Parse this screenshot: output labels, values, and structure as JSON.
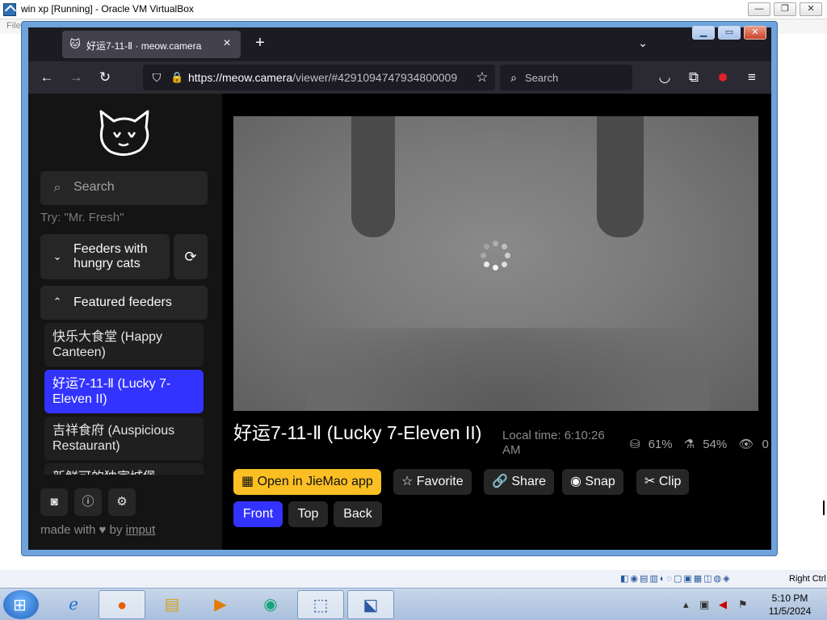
{
  "host": {
    "title": "win xp [Running] - Oracle VM VirtualBox",
    "menu_hint": "File",
    "tray_hostkey": "Right Ctrl"
  },
  "browser": {
    "tab_title": "好运7-11-Ⅱ · meow.camera",
    "url_host": "https://meow.camera",
    "url_path": "/viewer/#4291094747934800009",
    "search_placeholder": "Search"
  },
  "sidebar": {
    "search_placeholder": "Search",
    "try_hint": "Try: \"Mr. Fresh\"",
    "feeders_with_hungry": "Feeders with hungry cats",
    "featured_label": "Featured feeders",
    "featured": [
      {
        "label": "快乐大食堂 (Happy Canteen)"
      },
      {
        "label": "好运7-11-Ⅱ (Lucky 7-Eleven II)"
      },
      {
        "label": "吉祥食府 (Auspicious Restaurant)"
      },
      {
        "label": "新鲜可的独家城堡"
      }
    ],
    "made_with": "made with",
    "by": "by",
    "author": "imput"
  },
  "feed": {
    "title": "好运7-11-Ⅱ (Lucky 7-Eleven II)",
    "local_time": "Local time: 6:10:26 AM",
    "food_level": "61%",
    "water_level": "54%",
    "viewers": "0",
    "buttons": {
      "open_app": "Open in JieMao app",
      "favorite": "Favorite",
      "share": "Share",
      "snap": "Snap",
      "clip": "Clip"
    },
    "views": [
      "Front",
      "Top",
      "Back"
    ],
    "active_view": "Front"
  },
  "taskbar": {
    "time": "5:10 PM",
    "date": "11/5/2024"
  },
  "colors": {
    "accent_blue": "#3333ff",
    "primary_yellow": "#fbbf24",
    "page_bg": "#000000",
    "sidebar_bg": "#141414"
  }
}
